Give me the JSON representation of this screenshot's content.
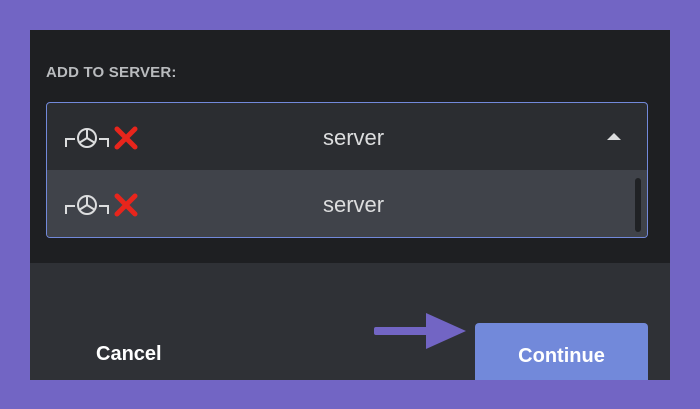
{
  "section_label": "ADD TO SERVER:",
  "select": {
    "selected": {
      "icon": "server-icon",
      "status_icon": "red-x-icon",
      "label": "server"
    },
    "options": [
      {
        "icon": "server-icon",
        "status_icon": "red-x-icon",
        "label": "server"
      }
    ]
  },
  "footer": {
    "cancel_label": "Cancel",
    "continue_label": "Continue"
  },
  "colors": {
    "background": "#7265c4",
    "panel": "#1e1f22",
    "footer": "#2f3136",
    "accent": "#7289da",
    "error_x": "#e8251c"
  }
}
